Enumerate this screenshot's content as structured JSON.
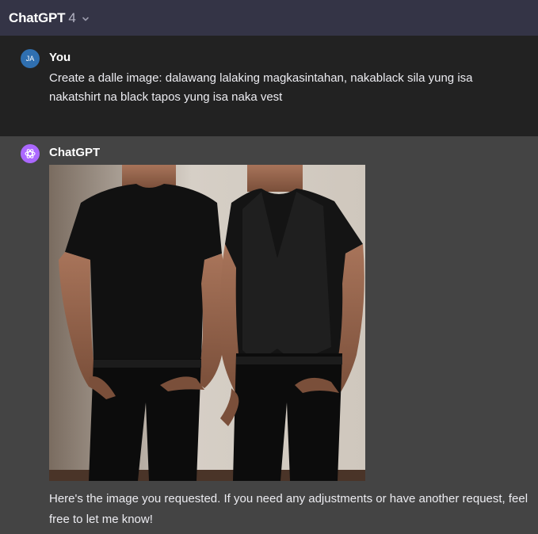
{
  "header": {
    "model_name": "ChatGPT",
    "model_version": "4"
  },
  "user_message": {
    "avatar_initials": "JA",
    "author": "You",
    "text": "Create a dalle image: dalawang lalaking magkasintahan, nakablack sila yung isa nakatshirt na black tapos yung isa naka vest"
  },
  "assistant_message": {
    "author": "ChatGPT",
    "text": "Here's the image you requested. If you need any adjustments or have another request, feel free to let me know!"
  },
  "colors": {
    "top_bar": "#343446",
    "user_bg": "#222222",
    "assistant_bg": "#444444",
    "user_avatar": "#2f6fb0",
    "gpt_avatar": "#ab68ff"
  },
  "icons": [
    "chevron-down-icon",
    "openai-logo-icon"
  ]
}
